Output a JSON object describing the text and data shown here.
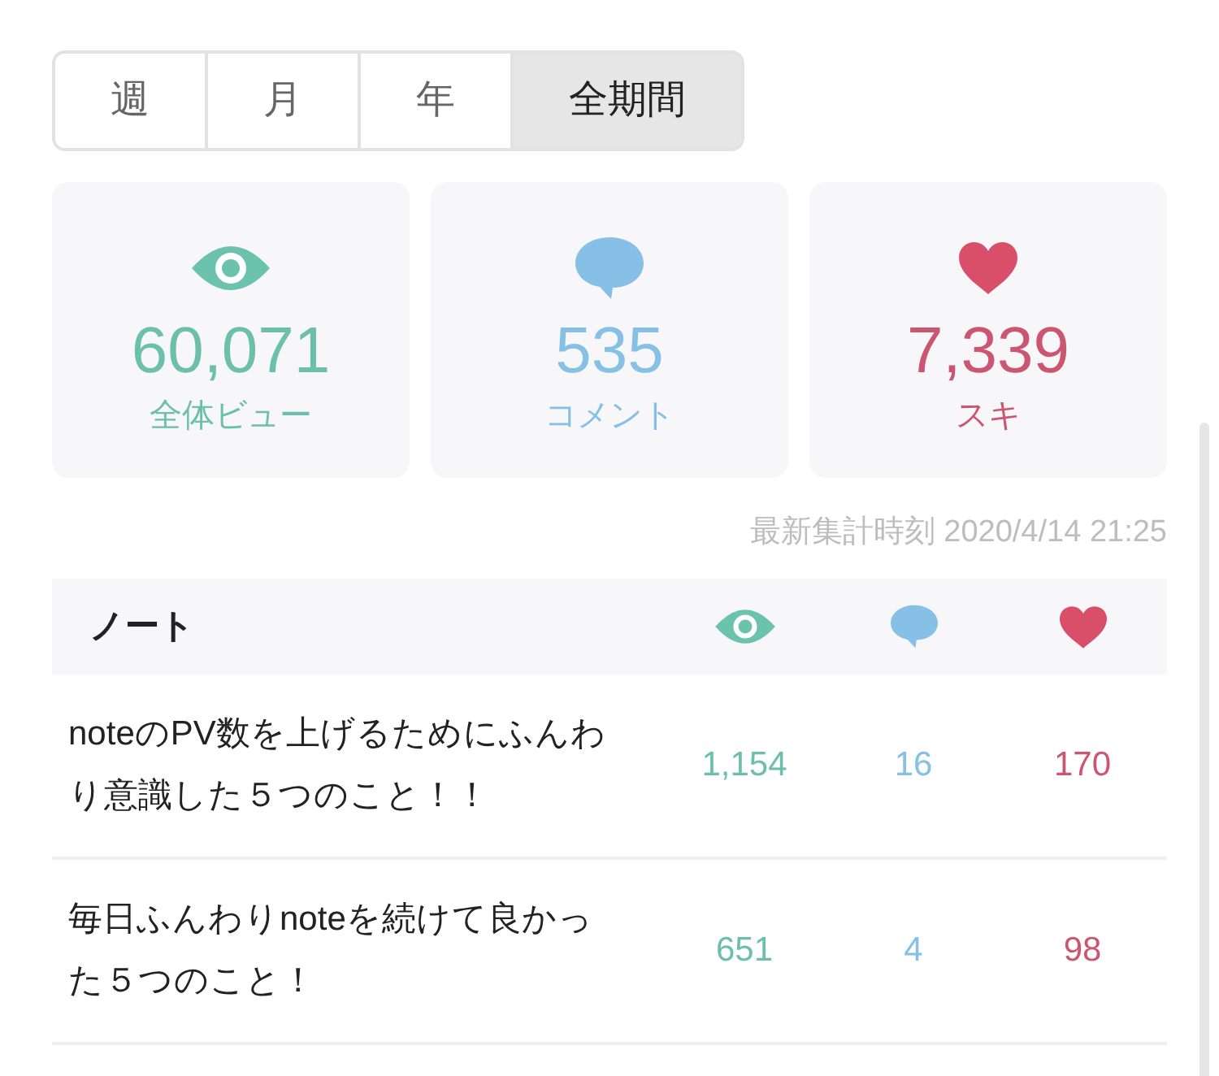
{
  "period_tabs": [
    {
      "label": "週",
      "selected": false
    },
    {
      "label": "月",
      "selected": false
    },
    {
      "label": "年",
      "selected": false
    },
    {
      "label": "全期間",
      "selected": true
    }
  ],
  "stats": [
    {
      "kind": "views",
      "value": "60,071",
      "label": "全体ビュー"
    },
    {
      "kind": "comments",
      "value": "535",
      "label": "コメント"
    },
    {
      "kind": "likes",
      "value": "7,339",
      "label": "スキ"
    }
  ],
  "updated_at": "最新集計時刻 2020/4/14 21:25",
  "table": {
    "columns": [
      {
        "kind": "title",
        "label": "ノート"
      },
      {
        "kind": "views"
      },
      {
        "kind": "comments"
      },
      {
        "kind": "likes"
      }
    ],
    "rows": [
      {
        "cells": [
          "noteのPV数を上げるためにふんわり意識した５つのこと！！",
          "1,154",
          "16",
          "170"
        ]
      },
      {
        "cells": [
          "毎日ふんわりnoteを続けて良かった５つのこと！",
          "651",
          "4",
          "98"
        ]
      }
    ]
  }
}
